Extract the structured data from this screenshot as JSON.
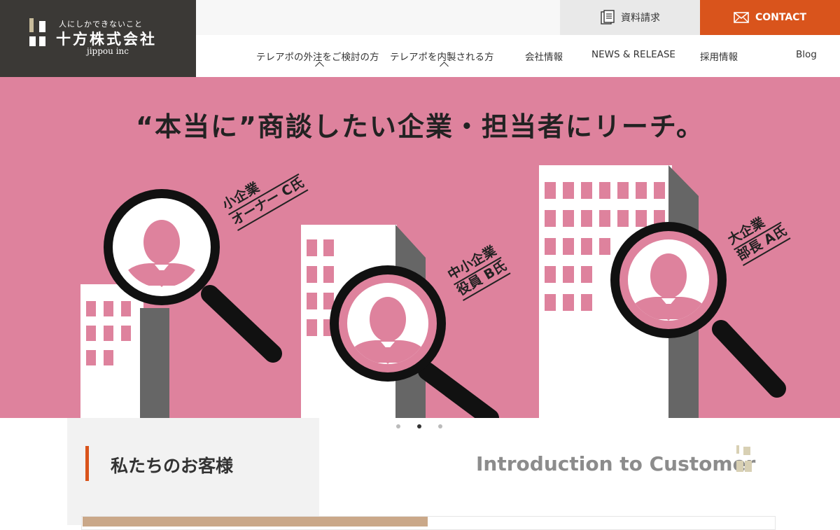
{
  "logo": {
    "tagline": "人にしかできないこと",
    "name": "十方株式会社",
    "name_en": "jippou inc"
  },
  "topbar": {
    "doc_request": "資料請求",
    "doc_icon": "document-icon",
    "contact": "CONTACT",
    "contact_icon": "mail-icon"
  },
  "nav": {
    "items": [
      "テレアポの外注をご検討の方",
      "テレアポを内製される方",
      "会社情報",
      "NEWS & RELEASE",
      "採用情報",
      "Blog"
    ]
  },
  "hero": {
    "headline": "“本当に”商談したい企業・担当者にリーチ。",
    "tags": [
      {
        "line1": "小企業",
        "line2": "オーナー C氏"
      },
      {
        "line1": "中小企業",
        "line2": "役員 B氏"
      },
      {
        "line1": "大企業",
        "line2": "部長 A氏"
      }
    ]
  },
  "carousel": {
    "count": 3,
    "active": 2
  },
  "section": {
    "title": "私たちのお客様",
    "title_en": "Introduction to Customer"
  },
  "colors": {
    "brand_dark": "#3b3936",
    "accent": "#d9541c",
    "hero_pink": "#de829d",
    "logo_beige": "#c8bc9b"
  }
}
